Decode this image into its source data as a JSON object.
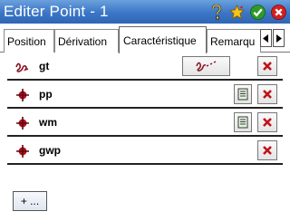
{
  "window": {
    "title": "Editer Point - 1"
  },
  "titlebar_icons": [
    {
      "name": "help-icon",
      "glyph": "?"
    },
    {
      "name": "star-icon",
      "glyph": "★"
    },
    {
      "name": "ok-icon",
      "glyph": "✔"
    },
    {
      "name": "close-icon",
      "glyph": "✖"
    }
  ],
  "tabs": [
    {
      "label": "Position",
      "active": false
    },
    {
      "label": "Dérivation",
      "active": false
    },
    {
      "label": "Caractéristique",
      "active": true
    },
    {
      "label": "Remarqu",
      "active": false
    }
  ],
  "features": [
    {
      "name": "gt",
      "type": "line",
      "has_attributes": false
    },
    {
      "name": "pp",
      "type": "point",
      "has_attributes": true
    },
    {
      "name": "wm",
      "type": "point",
      "has_attributes": true
    },
    {
      "name": "gwp",
      "type": "point",
      "has_attributes": false
    }
  ],
  "add_button": {
    "label": "+ ..."
  },
  "colors": {
    "title_gradient_top": "#6aa0dc",
    "title_gradient_bottom": "#2f66b5",
    "delete_x": "#c0121b",
    "line_feature": "#8a1020",
    "point_feature": "#b01020"
  }
}
